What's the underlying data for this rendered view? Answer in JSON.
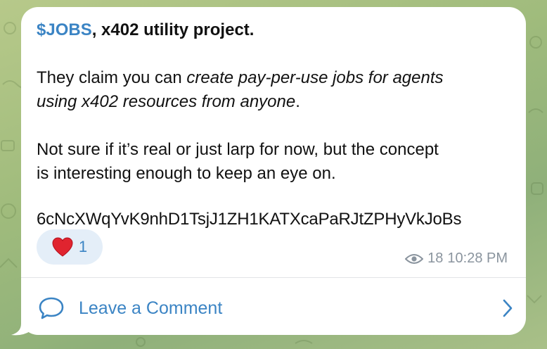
{
  "message": {
    "ticker": "$JOBS",
    "headline_rest": ", x402 utility project.",
    "para1_prefix": "They claim you can ",
    "para1_italic_line1": "create pay-per-use jobs for agents",
    "para1_italic_line2": "using x402 resources from anyone",
    "para1_suffix": ".",
    "para2_line1": "Not sure if it’s real or just larp for now, but the concept",
    "para2_line2": "is interesting enough to keep an eye on.",
    "contract_address": "6cNcXWqYvK9nhD1TsjJ1ZH1KATXcaPaRJtZPHyVkJoBs"
  },
  "reaction": {
    "icon": "heart-icon",
    "count": "1"
  },
  "meta": {
    "views_icon": "eye-icon",
    "views": "18",
    "time": "10:28 PM"
  },
  "comment": {
    "label": "Leave a Comment",
    "icon": "comment-bubble-icon",
    "chevron": "chevron-right-icon"
  },
  "colors": {
    "accent": "#3b84c4",
    "heart": "#e0242f",
    "meta": "#8a949e",
    "reaction_bg": "#e4eef8"
  }
}
